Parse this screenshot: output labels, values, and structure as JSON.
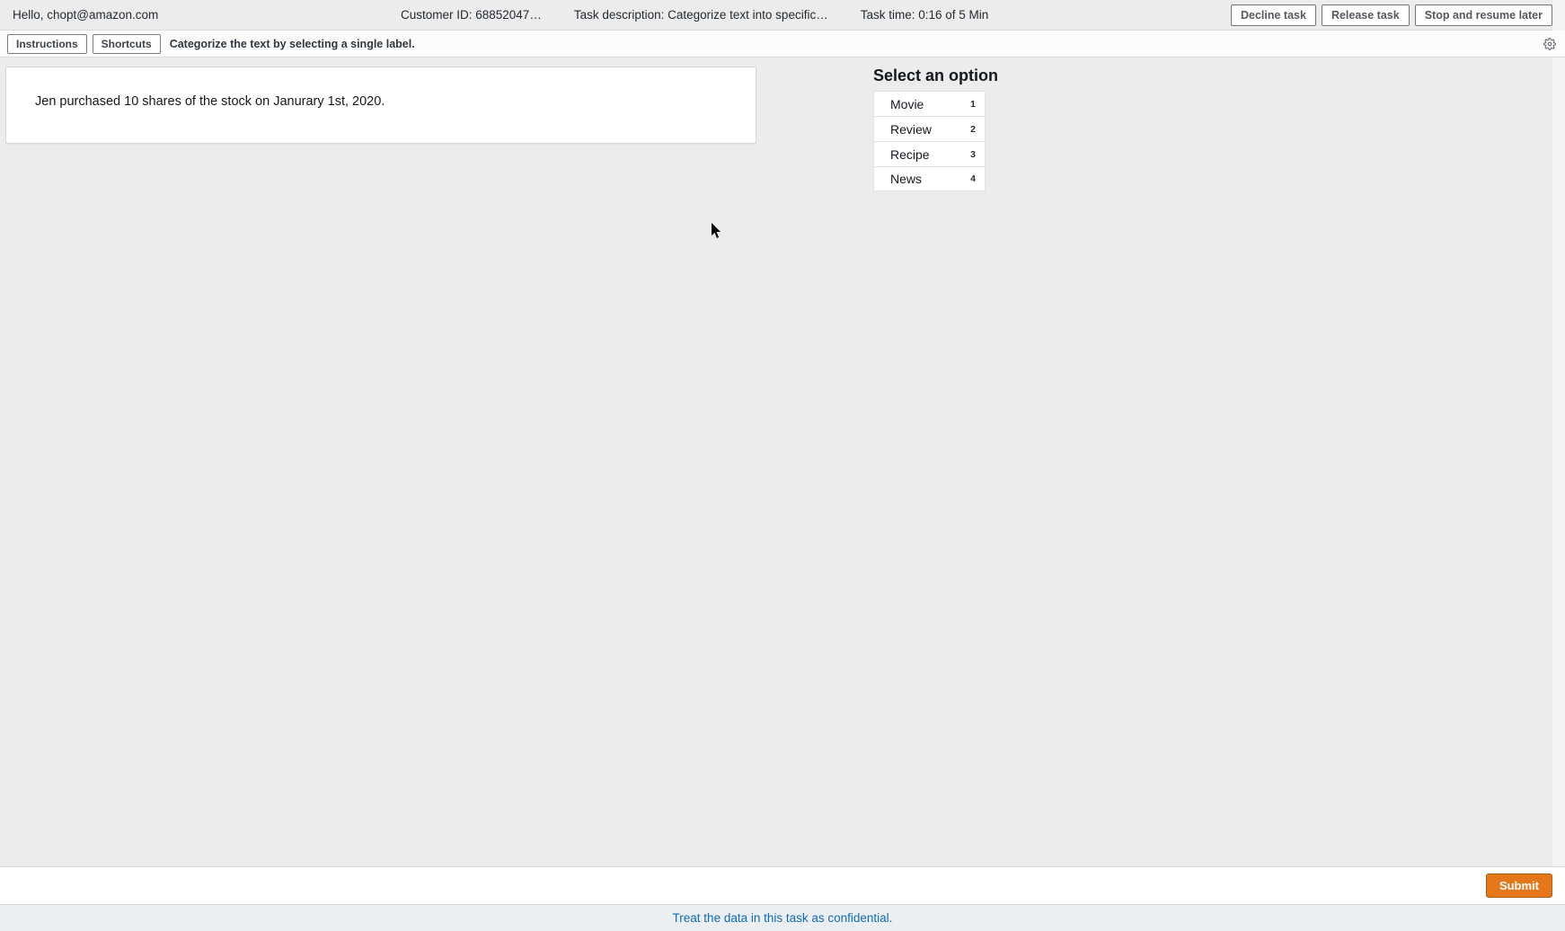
{
  "header": {
    "greeting": "Hello, chopt@amazon.com",
    "customer_id_label": "Customer ID: 68852047…",
    "task_description_label": "Task description: Categorize text into specific…",
    "task_time_label": "Task time: 0:16 of 5 Min",
    "decline_label": "Decline task",
    "release_label": "Release task",
    "stop_resume_label": "Stop and resume later"
  },
  "sub": {
    "instructions_label": "Instructions",
    "shortcuts_label": "Shortcuts",
    "task_hint": "Categorize the text by selecting a single label."
  },
  "task": {
    "text": "Jen purchased 10 shares of the stock on Janurary 1st, 2020."
  },
  "options": {
    "title": "Select an option",
    "items": [
      {
        "label": "Movie",
        "shortcut": "1"
      },
      {
        "label": "Review",
        "shortcut": "2"
      },
      {
        "label": "Recipe",
        "shortcut": "3"
      },
      {
        "label": "News",
        "shortcut": "4"
      }
    ]
  },
  "footer": {
    "submit_label": "Submit",
    "confidential_text": "Treat the data in this task as confidential."
  }
}
